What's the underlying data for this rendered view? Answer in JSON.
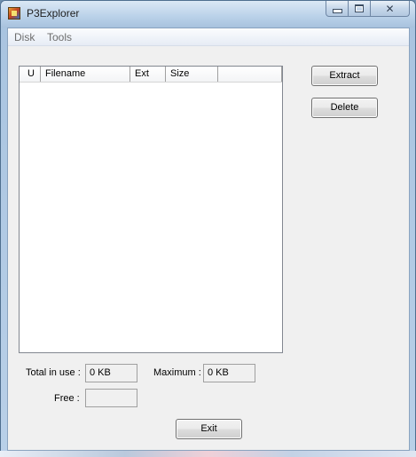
{
  "window": {
    "title": "P3Explorer",
    "icons": {
      "app": "app-icon",
      "minimize": "minimize-icon",
      "maximize": "maximize-icon",
      "close": "close-icon"
    },
    "close_glyph": "✕"
  },
  "menu": {
    "items": [
      {
        "label": "Disk"
      },
      {
        "label": "Tools"
      }
    ]
  },
  "file_list": {
    "columns": [
      {
        "label": "U"
      },
      {
        "label": "Filename"
      },
      {
        "label": "Ext"
      },
      {
        "label": "Size"
      },
      {
        "label": ""
      }
    ],
    "rows": []
  },
  "buttons": {
    "extract": "Extract",
    "delete": "Delete",
    "exit": "Exit"
  },
  "stats": {
    "total_in_use_label": "Total in use :",
    "total_in_use_value": "0 KB",
    "maximum_label": "Maximum :",
    "maximum_value": "0 KB",
    "free_label": "Free :",
    "free_value": ""
  }
}
